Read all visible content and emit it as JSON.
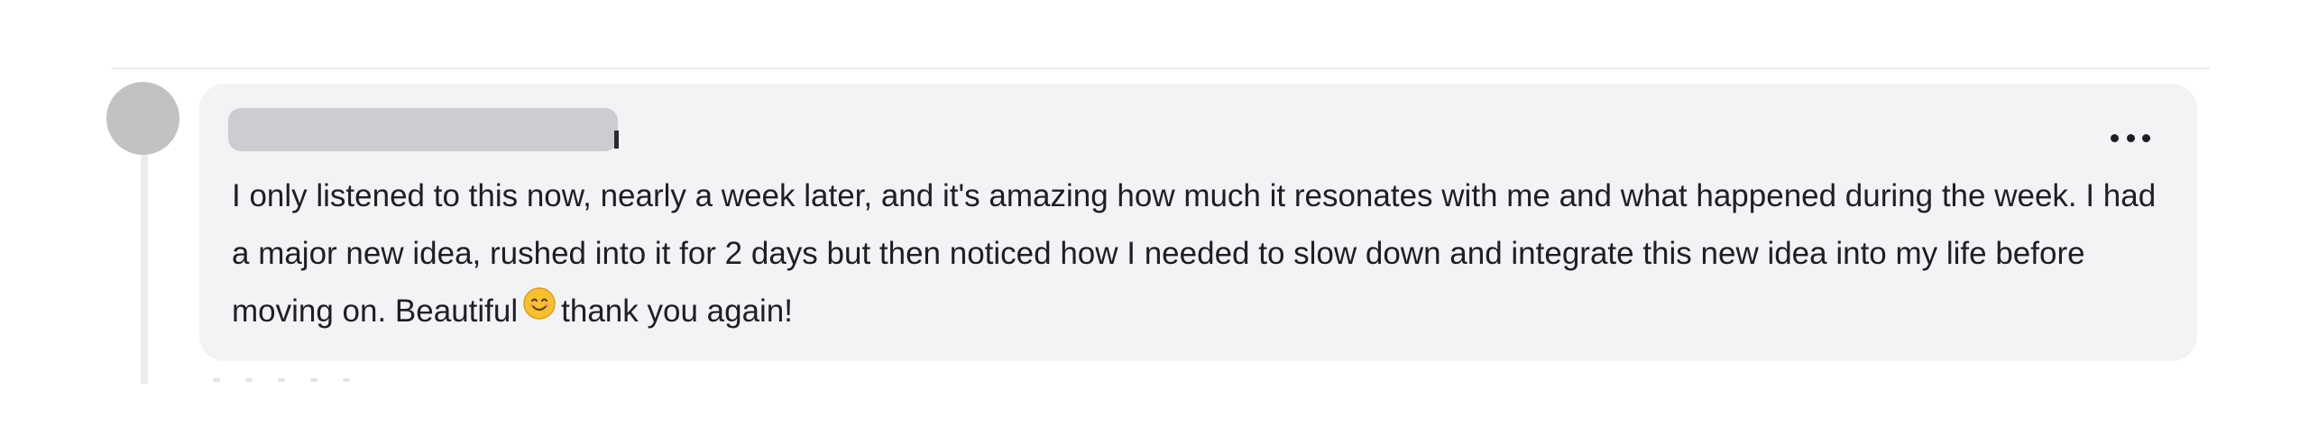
{
  "comment": {
    "author_name": "",
    "more_icon": "more-horizontal-icon",
    "text_before_emoji": "I only listened to this now, nearly a week later, and it's amazing how much it resonates with me and what happened during the week. I had a major new idea, rushed into it for 2 days but then noticed how I needed to slow down and integrate this new idea into my life before moving on. Beautiful",
    "emoji_icon": "smiling-face-emoji-icon",
    "text_after_emoji": "thank you again!"
  },
  "colors": {
    "bubble_background": "#f2f3f5",
    "avatar_placeholder": "#c2c2c5",
    "text": "#1f1f23"
  }
}
